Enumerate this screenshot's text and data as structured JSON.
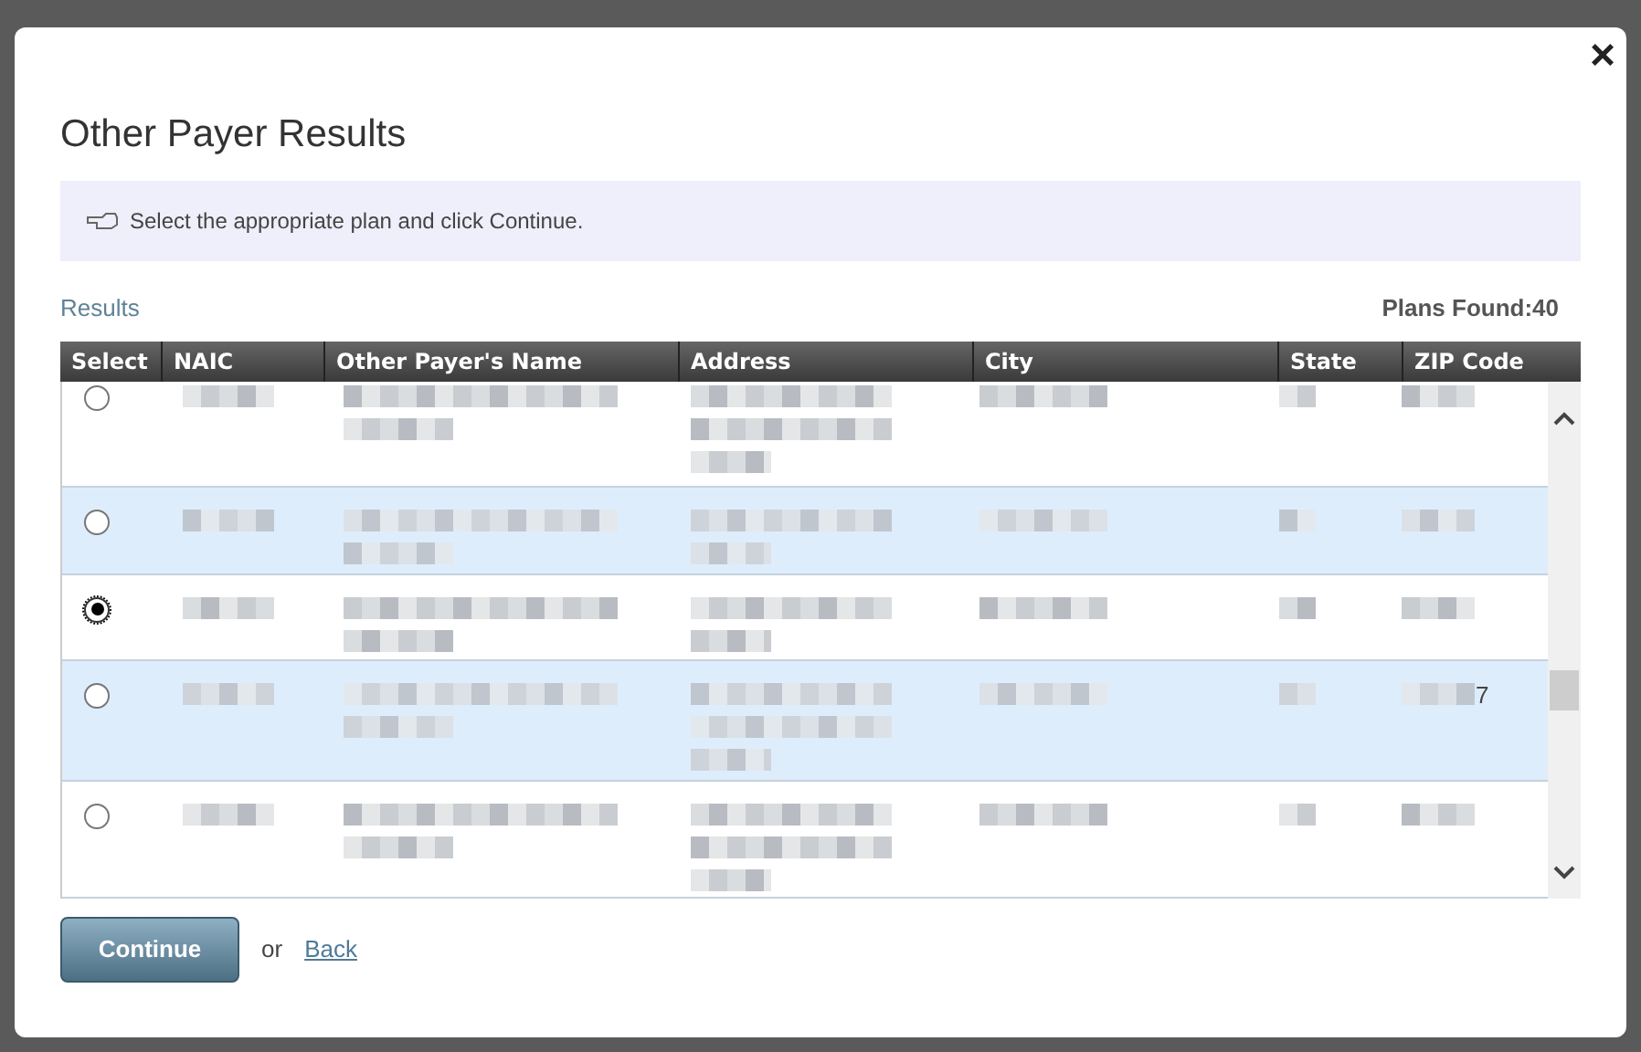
{
  "dialog": {
    "title": "Other Payer Results",
    "close": "×"
  },
  "instruction": "Select the appropriate plan and click Continue.",
  "results_label": "Results",
  "plans_found": "Plans Found:40",
  "table": {
    "columns": [
      "Select",
      "NAIC",
      "Other Payer's Name",
      "Address",
      "City",
      "State",
      "ZIP Code"
    ],
    "rows": [
      {
        "selected": false,
        "highlighted": false
      },
      {
        "selected": false,
        "highlighted": true
      },
      {
        "selected": true,
        "highlighted": false
      },
      {
        "selected": false,
        "highlighted": true,
        "zip_tail": "7"
      },
      {
        "selected": false,
        "highlighted": false
      }
    ]
  },
  "actions": {
    "continue": "Continue",
    "or": "or",
    "back": "Back"
  }
}
